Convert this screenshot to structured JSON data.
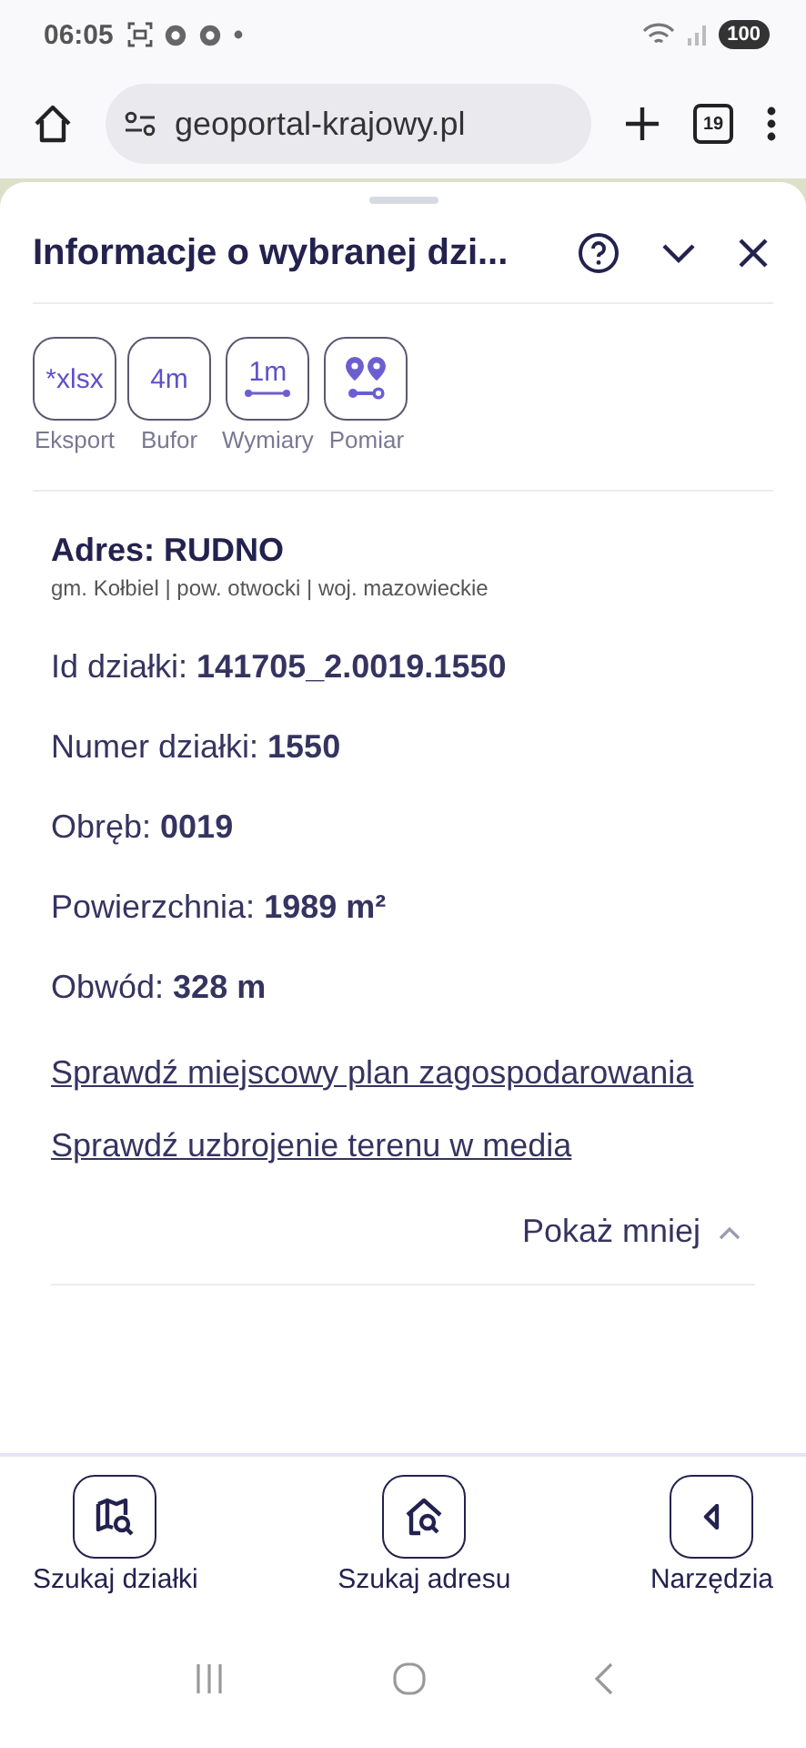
{
  "status_bar": {
    "time": "06:05",
    "battery": "100"
  },
  "browser": {
    "url": "geoportal-krajowy.pl",
    "tab_count": "19"
  },
  "panel": {
    "title": "Informacje o wybranej dzi...",
    "tools": [
      {
        "kind": "text",
        "icon_text": "*xlsx",
        "label": "Eksport"
      },
      {
        "kind": "text",
        "icon_text": "4m",
        "label": "Bufor"
      },
      {
        "kind": "measure",
        "icon_text": "1m",
        "label": "Wymiary"
      },
      {
        "kind": "pins",
        "label": "Pomiar"
      }
    ],
    "address": {
      "title": "Adres: RUDNO",
      "subtitle": "gm. Kołbiel | pow. otwocki | woj. mazowieckie"
    },
    "fields": [
      "Id działki: **141705_2.0019.1550**",
      "Numer działki: **1550**",
      "Obręb: **0019**",
      "Powierzchnia: **1989 m²**",
      "Obwód: **328 m**"
    ],
    "links": [
      "Sprawdź miejscowy plan zagospodarowania",
      "Sprawdź uzbrojenie terenu w media"
    ],
    "toggle": "Pokaż mniej"
  },
  "bottom_nav": [
    {
      "kind": "parcel",
      "label": "Szukaj działki"
    },
    {
      "kind": "address",
      "label": "Szukaj adresu"
    },
    {
      "kind": "tools",
      "label": "Narzędzia"
    }
  ]
}
